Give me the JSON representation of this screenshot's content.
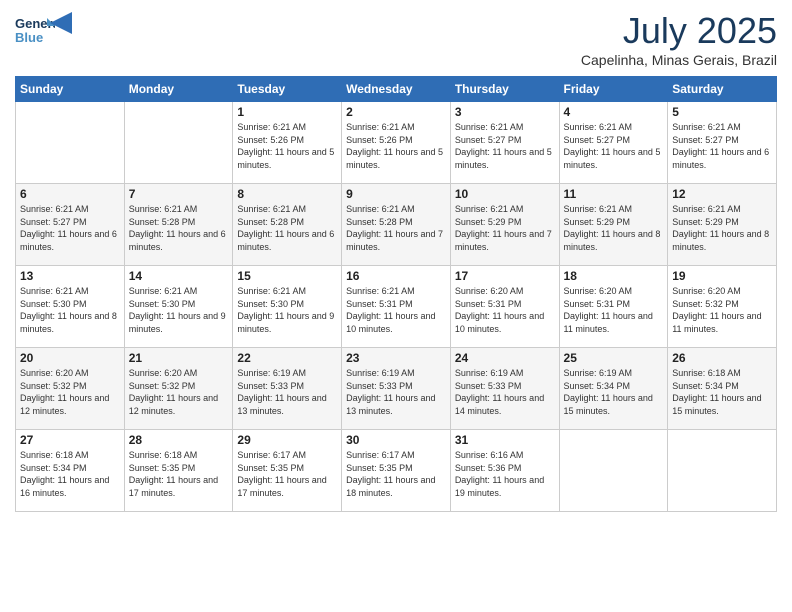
{
  "header": {
    "logo_line1": "General",
    "logo_line2": "Blue",
    "month_year": "July 2025",
    "location": "Capelinha, Minas Gerais, Brazil"
  },
  "days_of_week": [
    "Sunday",
    "Monday",
    "Tuesday",
    "Wednesday",
    "Thursday",
    "Friday",
    "Saturday"
  ],
  "weeks": [
    [
      {
        "day": "",
        "info": ""
      },
      {
        "day": "",
        "info": ""
      },
      {
        "day": "1",
        "info": "Sunrise: 6:21 AM\nSunset: 5:26 PM\nDaylight: 11 hours and 5 minutes."
      },
      {
        "day": "2",
        "info": "Sunrise: 6:21 AM\nSunset: 5:26 PM\nDaylight: 11 hours and 5 minutes."
      },
      {
        "day": "3",
        "info": "Sunrise: 6:21 AM\nSunset: 5:27 PM\nDaylight: 11 hours and 5 minutes."
      },
      {
        "day": "4",
        "info": "Sunrise: 6:21 AM\nSunset: 5:27 PM\nDaylight: 11 hours and 5 minutes."
      },
      {
        "day": "5",
        "info": "Sunrise: 6:21 AM\nSunset: 5:27 PM\nDaylight: 11 hours and 6 minutes."
      }
    ],
    [
      {
        "day": "6",
        "info": "Sunrise: 6:21 AM\nSunset: 5:27 PM\nDaylight: 11 hours and 6 minutes."
      },
      {
        "day": "7",
        "info": "Sunrise: 6:21 AM\nSunset: 5:28 PM\nDaylight: 11 hours and 6 minutes."
      },
      {
        "day": "8",
        "info": "Sunrise: 6:21 AM\nSunset: 5:28 PM\nDaylight: 11 hours and 6 minutes."
      },
      {
        "day": "9",
        "info": "Sunrise: 6:21 AM\nSunset: 5:28 PM\nDaylight: 11 hours and 7 minutes."
      },
      {
        "day": "10",
        "info": "Sunrise: 6:21 AM\nSunset: 5:29 PM\nDaylight: 11 hours and 7 minutes."
      },
      {
        "day": "11",
        "info": "Sunrise: 6:21 AM\nSunset: 5:29 PM\nDaylight: 11 hours and 8 minutes."
      },
      {
        "day": "12",
        "info": "Sunrise: 6:21 AM\nSunset: 5:29 PM\nDaylight: 11 hours and 8 minutes."
      }
    ],
    [
      {
        "day": "13",
        "info": "Sunrise: 6:21 AM\nSunset: 5:30 PM\nDaylight: 11 hours and 8 minutes."
      },
      {
        "day": "14",
        "info": "Sunrise: 6:21 AM\nSunset: 5:30 PM\nDaylight: 11 hours and 9 minutes."
      },
      {
        "day": "15",
        "info": "Sunrise: 6:21 AM\nSunset: 5:30 PM\nDaylight: 11 hours and 9 minutes."
      },
      {
        "day": "16",
        "info": "Sunrise: 6:21 AM\nSunset: 5:31 PM\nDaylight: 11 hours and 10 minutes."
      },
      {
        "day": "17",
        "info": "Sunrise: 6:20 AM\nSunset: 5:31 PM\nDaylight: 11 hours and 10 minutes."
      },
      {
        "day": "18",
        "info": "Sunrise: 6:20 AM\nSunset: 5:31 PM\nDaylight: 11 hours and 11 minutes."
      },
      {
        "day": "19",
        "info": "Sunrise: 6:20 AM\nSunset: 5:32 PM\nDaylight: 11 hours and 11 minutes."
      }
    ],
    [
      {
        "day": "20",
        "info": "Sunrise: 6:20 AM\nSunset: 5:32 PM\nDaylight: 11 hours and 12 minutes."
      },
      {
        "day": "21",
        "info": "Sunrise: 6:20 AM\nSunset: 5:32 PM\nDaylight: 11 hours and 12 minutes."
      },
      {
        "day": "22",
        "info": "Sunrise: 6:19 AM\nSunset: 5:33 PM\nDaylight: 11 hours and 13 minutes."
      },
      {
        "day": "23",
        "info": "Sunrise: 6:19 AM\nSunset: 5:33 PM\nDaylight: 11 hours and 13 minutes."
      },
      {
        "day": "24",
        "info": "Sunrise: 6:19 AM\nSunset: 5:33 PM\nDaylight: 11 hours and 14 minutes."
      },
      {
        "day": "25",
        "info": "Sunrise: 6:19 AM\nSunset: 5:34 PM\nDaylight: 11 hours and 15 minutes."
      },
      {
        "day": "26",
        "info": "Sunrise: 6:18 AM\nSunset: 5:34 PM\nDaylight: 11 hours and 15 minutes."
      }
    ],
    [
      {
        "day": "27",
        "info": "Sunrise: 6:18 AM\nSunset: 5:34 PM\nDaylight: 11 hours and 16 minutes."
      },
      {
        "day": "28",
        "info": "Sunrise: 6:18 AM\nSunset: 5:35 PM\nDaylight: 11 hours and 17 minutes."
      },
      {
        "day": "29",
        "info": "Sunrise: 6:17 AM\nSunset: 5:35 PM\nDaylight: 11 hours and 17 minutes."
      },
      {
        "day": "30",
        "info": "Sunrise: 6:17 AM\nSunset: 5:35 PM\nDaylight: 11 hours and 18 minutes."
      },
      {
        "day": "31",
        "info": "Sunrise: 6:16 AM\nSunset: 5:36 PM\nDaylight: 11 hours and 19 minutes."
      },
      {
        "day": "",
        "info": ""
      },
      {
        "day": "",
        "info": ""
      }
    ]
  ]
}
